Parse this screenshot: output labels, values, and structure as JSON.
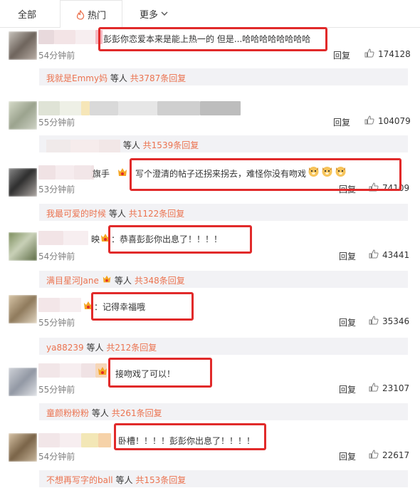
{
  "tabs": {
    "all": "全部",
    "hot": "热门",
    "more": "更多"
  },
  "reply_label": "回复",
  "others_suffix": "等人",
  "comments": [
    {
      "nick_suffix": "",
      "text": "彭彭你恋爱本来是能上热一的 但是...哈哈哈哈哈哈哈哈",
      "time": "54分钟前",
      "likes": "174128",
      "reply_user": "我就是Emmy妈",
      "reply_total": "共3787条回复"
    },
    {
      "nick_suffix": "",
      "text": "",
      "time": "55分钟前",
      "likes": "104079",
      "reply_user": "",
      "reply_total": "共1539条回复"
    },
    {
      "nick_suffix": "旗手",
      "text": "写个澄清的帖子还拐来拐去，难怪你没有吻戏",
      "time": "53分钟前",
      "likes": "74109",
      "reply_user": "我最可爱的时候",
      "reply_total": "共1122条回复"
    },
    {
      "nick_suffix": "映",
      "text": "：恭喜彭彭你出息了！！！！",
      "time": "54分钟前",
      "likes": "43441",
      "reply_user": "满目星河Jane",
      "reply_total": "共348条回复"
    },
    {
      "nick_suffix": "",
      "text": "：记得幸福哦",
      "time": "55分钟前",
      "likes": "35346",
      "reply_user": "ya88239",
      "reply_total": "共212条回复"
    },
    {
      "nick_suffix": "",
      "text": "接吻戏了可以！",
      "time": "55分钟前",
      "likes": "23107",
      "reply_user": "童颜粉粉粉",
      "reply_total": "共261条回复"
    },
    {
      "nick_suffix": "",
      "text": "卧槽！！！！彭彭你出息了！！！！",
      "time": "54分钟前",
      "likes": "22617",
      "reply_user": "不想再写字的ball",
      "reply_total": "共153条回复"
    }
  ],
  "colors": {
    "accent_orange": "#eb7350",
    "highlight_red": "#e12a2a",
    "reply_bar_bg": "#f2f2f5"
  },
  "icons": {
    "hot_tab": "fire-icon",
    "more_tab": "chevron-down-icon",
    "like": "thumbs-up-icon",
    "vip": "vip-badge-icon",
    "emoji": "dog-face-emoji-icon"
  }
}
